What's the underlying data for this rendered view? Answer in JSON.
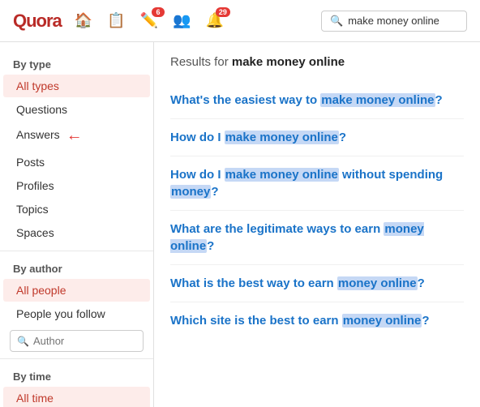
{
  "header": {
    "logo": "Quora",
    "search_placeholder": "make money online",
    "search_value": "make money online",
    "nav": [
      {
        "id": "home",
        "icon": "🏠",
        "badge": null
      },
      {
        "id": "feed",
        "icon": "📋",
        "badge": null
      },
      {
        "id": "edit",
        "icon": "✏️",
        "badge": "6"
      },
      {
        "id": "people",
        "icon": "👥",
        "badge": null
      },
      {
        "id": "bell",
        "icon": "🔔",
        "badge": "29"
      }
    ]
  },
  "sidebar": {
    "bytype_label": "By type",
    "type_items": [
      {
        "id": "all-types",
        "label": "All types",
        "active": true
      },
      {
        "id": "questions",
        "label": "Questions"
      },
      {
        "id": "answers",
        "label": "Answers",
        "arrow": true
      },
      {
        "id": "posts",
        "label": "Posts"
      },
      {
        "id": "profiles",
        "label": "Profiles"
      },
      {
        "id": "topics",
        "label": "Topics"
      },
      {
        "id": "spaces",
        "label": "Spaces"
      }
    ],
    "byauthor_label": "By author",
    "author_items": [
      {
        "id": "all-people",
        "label": "All people",
        "active": true
      },
      {
        "id": "people-you-follow",
        "label": "People you follow"
      }
    ],
    "author_search_placeholder": "Author",
    "bytime_label": "By time",
    "time_items": [
      {
        "id": "all-time",
        "label": "All time",
        "active": true
      }
    ]
  },
  "content": {
    "results_prefix": "Results for ",
    "results_query": "make money online",
    "results": [
      {
        "id": 1,
        "parts": [
          {
            "text": "What's the easiest way to ",
            "highlight": false
          },
          {
            "text": "make money online",
            "highlight": true
          },
          {
            "text": "?",
            "highlight": false
          }
        ]
      },
      {
        "id": 2,
        "parts": [
          {
            "text": "How do I ",
            "highlight": false
          },
          {
            "text": "make money online",
            "highlight": true
          },
          {
            "text": "?",
            "highlight": false
          }
        ]
      },
      {
        "id": 3,
        "parts": [
          {
            "text": "How do I ",
            "highlight": false
          },
          {
            "text": "make money online",
            "highlight": true
          },
          {
            "text": " without spending ",
            "highlight": false
          },
          {
            "text": "money",
            "highlight": true
          },
          {
            "text": "?",
            "highlight": false
          }
        ]
      },
      {
        "id": 4,
        "parts": [
          {
            "text": "What are the legitimate ways to earn ",
            "highlight": false
          },
          {
            "text": "money online",
            "highlight": true
          },
          {
            "text": "?",
            "highlight": false
          }
        ]
      },
      {
        "id": 5,
        "parts": [
          {
            "text": "What is the best way to earn ",
            "highlight": false
          },
          {
            "text": "money online",
            "highlight": true
          },
          {
            "text": "?",
            "highlight": false
          }
        ]
      },
      {
        "id": 6,
        "parts": [
          {
            "text": "Which site is the best to earn ",
            "highlight": false
          },
          {
            "text": "money online",
            "highlight": true
          },
          {
            "text": "?",
            "highlight": false
          }
        ]
      }
    ]
  }
}
